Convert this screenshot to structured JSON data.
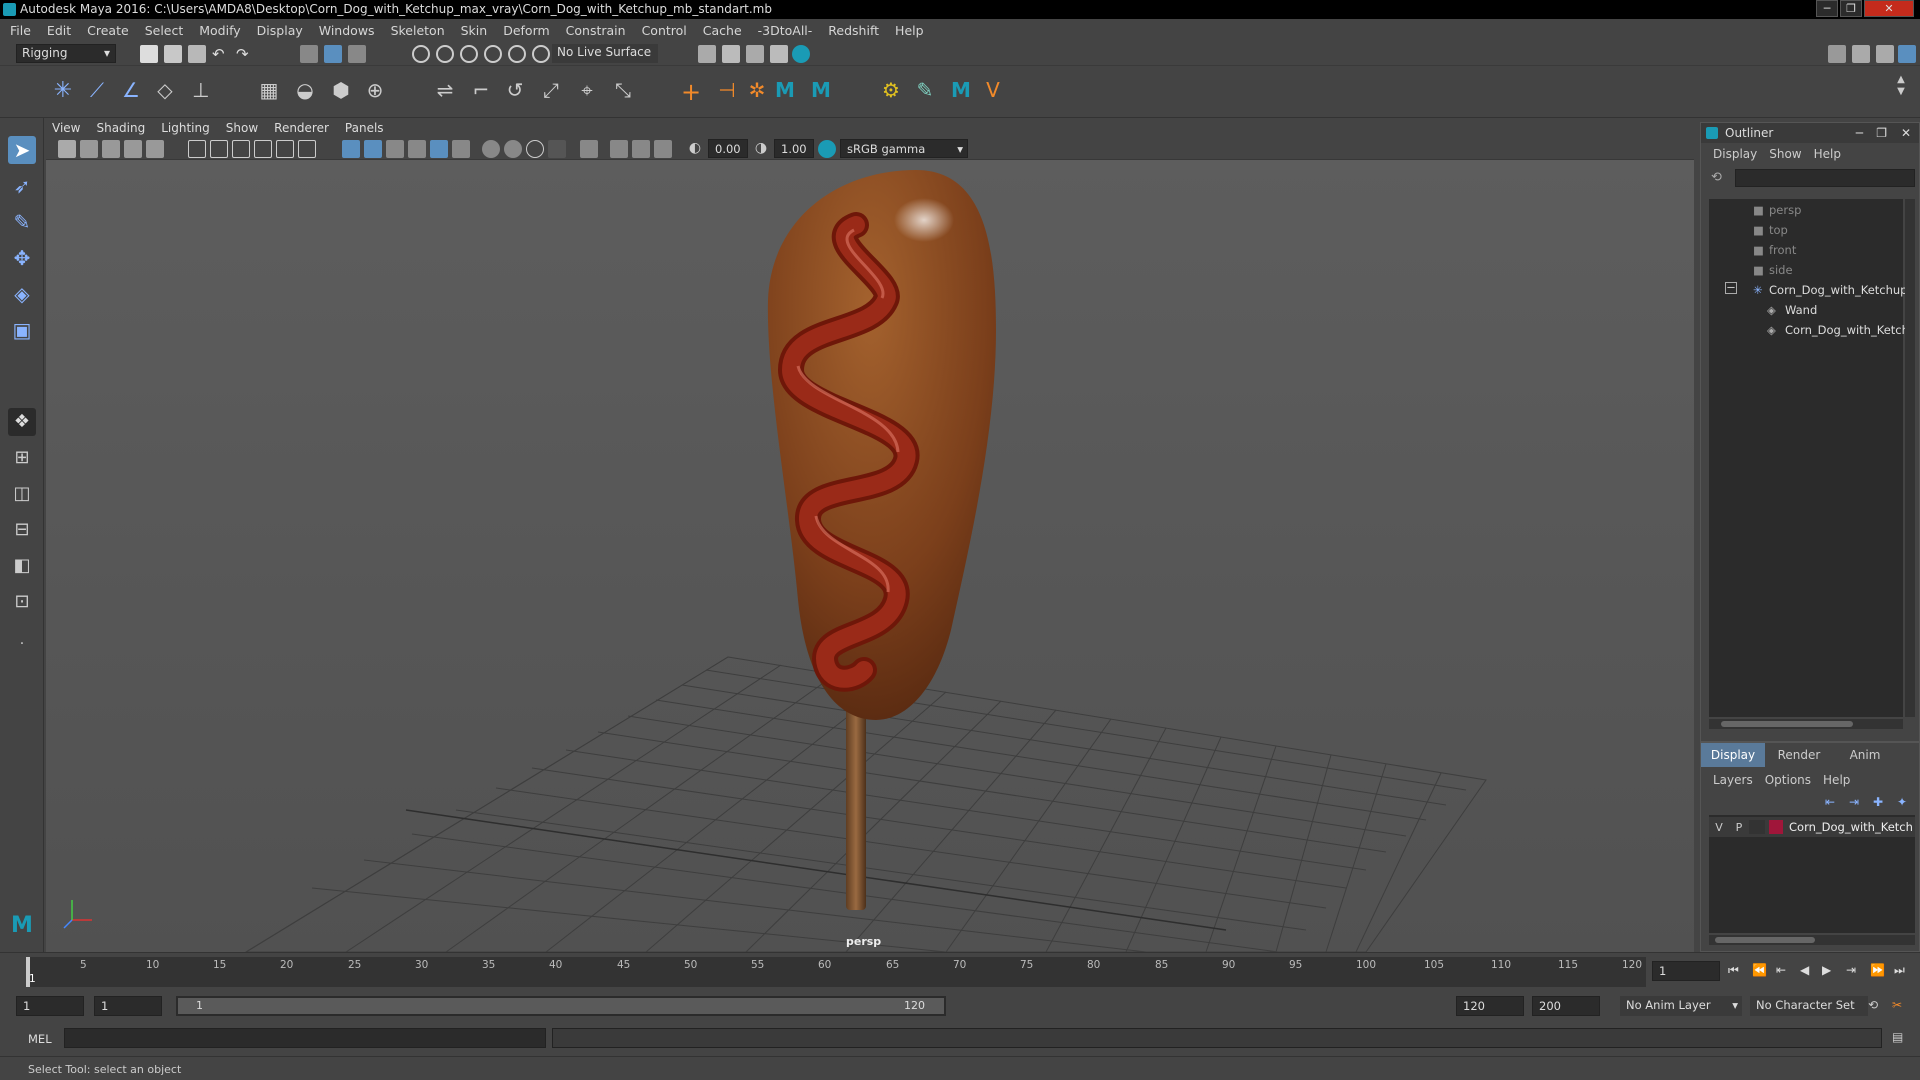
{
  "window": {
    "title": "Autodesk Maya 2016: C:\\Users\\AMDA8\\Desktop\\Corn_Dog_with_Ketchup_max_vray\\Corn_Dog_with_Ketchup_mb_standart.mb"
  },
  "menubar": [
    "File",
    "Edit",
    "Create",
    "Select",
    "Modify",
    "Display",
    "Windows",
    "Skeleton",
    "Skin",
    "Deform",
    "Constrain",
    "Control",
    "Cache",
    "-3DtoAll-",
    "Redshift",
    "Help"
  ],
  "statusline": {
    "mode": "Rigging",
    "live_surface": "No Live Surface"
  },
  "viewport": {
    "menu": [
      "View",
      "Shading",
      "Lighting",
      "Show",
      "Renderer",
      "Panels"
    ],
    "exposure": "0.00",
    "gamma": "1.00",
    "colorspace": "sRGB gamma",
    "camera": "persp"
  },
  "outliner": {
    "title": "Outliner",
    "menu": [
      "Display",
      "Show",
      "Help"
    ],
    "items": [
      {
        "label": "persp",
        "dim": true
      },
      {
        "label": "top",
        "dim": true
      },
      {
        "label": "front",
        "dim": true
      },
      {
        "label": "side",
        "dim": true
      },
      {
        "label": "Corn_Dog_with_Ketchup_",
        "dim": false
      },
      {
        "label": "Wand",
        "dim": false
      },
      {
        "label": "Corn_Dog_with_Ketch",
        "dim": false
      }
    ]
  },
  "layers": {
    "tabs": [
      "Display",
      "Render",
      "Anim"
    ],
    "menu": [
      "Layers",
      "Options",
      "Help"
    ],
    "row": {
      "v": "V",
      "p": "P",
      "name": "Corn_Dog_with_Ketch",
      "color": "#a0163a"
    }
  },
  "timeline": {
    "ticks": [
      "1",
      "5",
      "10",
      "15",
      "20",
      "25",
      "30",
      "35",
      "40",
      "45",
      "50",
      "55",
      "60",
      "65",
      "70",
      "75",
      "80",
      "85",
      "90",
      "95",
      "100",
      "105",
      "110",
      "115",
      "120"
    ],
    "current_frame": "1"
  },
  "range": {
    "start": "1",
    "playback_start": "1",
    "slider_start": "1",
    "slider_end": "120",
    "playback_end": "120",
    "end": "200",
    "anim_layer": "No Anim Layer",
    "character_set": "No Character Set"
  },
  "cmdline": {
    "label": "MEL"
  },
  "helpline": {
    "text": "Select Tool: select an object"
  },
  "colors": {
    "accent": "#1a9bb5",
    "bg": "#444444",
    "ketchup": "#8b1f14",
    "cornbread": "#8b4a22"
  }
}
